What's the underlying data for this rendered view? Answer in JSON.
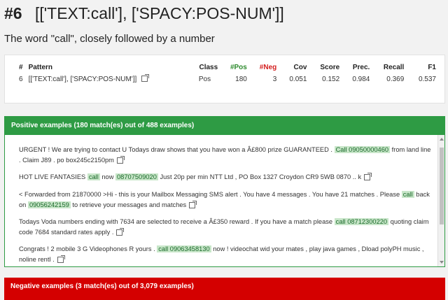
{
  "header": {
    "number": "#6",
    "pattern_title": "[['TEXT:call'], ['SPACY:POS-NUM']]",
    "subtitle": "The word \"call\", closely followed by a number"
  },
  "stats": {
    "columns": [
      "#",
      "Pattern",
      "Class",
      "#Pos",
      "#Neg",
      "Cov",
      "Score",
      "Prec.",
      "Recall",
      "F1"
    ],
    "row": {
      "index": "6",
      "pattern": "[['TEXT:call'], ['SPACY:POS-NUM']]",
      "class": "Pos",
      "pos": "180",
      "neg": "3",
      "cov": "0.051",
      "score": "0.152",
      "prec": "0.984",
      "recall": "0.369",
      "f1": "0.537"
    }
  },
  "positive": {
    "heading": "Positive examples (180 match(es) out of 488 examples)",
    "examples": [
      {
        "parts": [
          "URGENT ! We are trying to contact U Todays draw shows that you have won a Â£800 prize GUARANTEED . ",
          "Call 09050000460",
          " from land line . Claim J89 . po box245c2150pm"
        ]
      },
      {
        "parts": [
          "HOT LIVE FANTASIES ",
          "call",
          " now ",
          "08707509020",
          " Just 20p per min NTT Ltd , PO Box 1327 Croydon CR9 5WB 0870 .. k"
        ]
      },
      {
        "parts": [
          "< Forwarded from 21870000 >Hi - this is your Mailbox Messaging SMS alert . You have 4 messages . You have 21 matches . Please ",
          "call",
          " back on ",
          "09056242159",
          " to retrieve your messages and matches"
        ]
      },
      {
        "parts": [
          "Todays Voda numbers ending with 7634 are selected to receive a Â£350 reward . If you have a match please ",
          "call 08712300220",
          " quoting claim code 7684 standard rates apply ."
        ]
      },
      {
        "parts": [
          "Congrats ! 2 mobile 3 G Videophones R yours . ",
          "call 09063458130",
          " now ! videochat wid your mates , play java games , Dload polyPH music , noline rentl ."
        ]
      }
    ]
  },
  "negative": {
    "heading": "Negative examples (3 match(es) out of 3,079 examples)"
  },
  "colors": {
    "positive_green": "#2e9b44",
    "negative_red": "#d40000",
    "highlight_bg": "#c8e6c9"
  }
}
